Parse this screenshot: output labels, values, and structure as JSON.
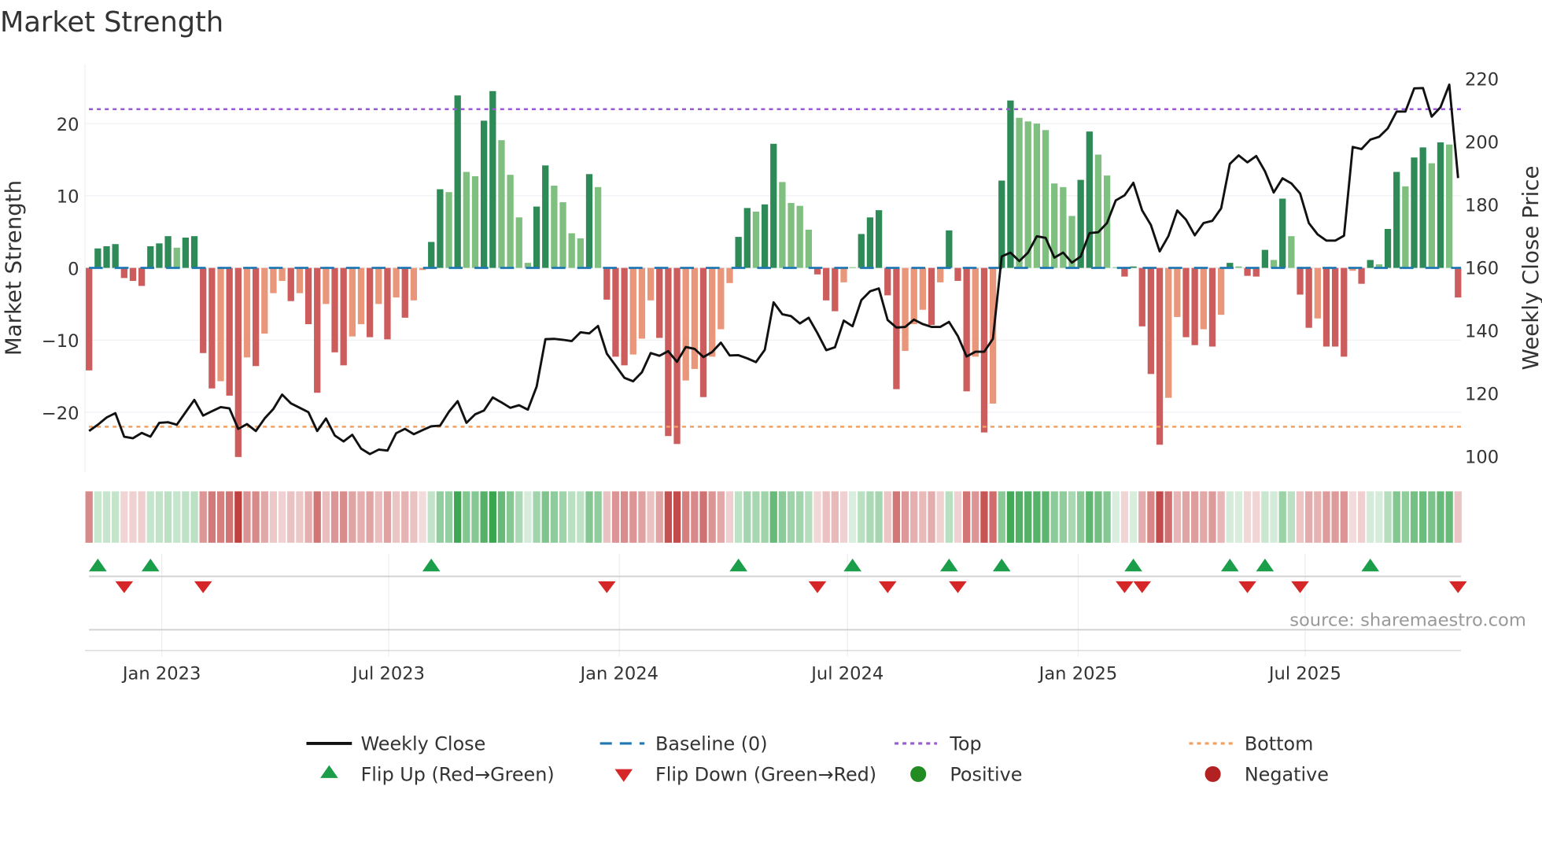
{
  "title": "Market Strength",
  "source": "source: sharemaestro.com",
  "colors": {
    "strong_green": "#2e8b57",
    "weak_green": "#7fbf7f",
    "strong_red": "#cd5c5c",
    "weak_red": "#e9967a",
    "line": "#111111",
    "baseline": "#1f77b4",
    "top": "#9b59d6",
    "bottom": "#f0a060",
    "flip_up": "#1a9e4a",
    "flip_down": "#d62728",
    "positive": "#228b22",
    "negative": "#b22222"
  },
  "legend": [
    {
      "key": "weekly_close",
      "label": "Weekly Close"
    },
    {
      "key": "baseline",
      "label": "Baseline (0)"
    },
    {
      "key": "top",
      "label": "Top"
    },
    {
      "key": "bottom",
      "label": "Bottom"
    },
    {
      "key": "flip_up",
      "label": "Flip Up (Red→Green)"
    },
    {
      "key": "flip_down",
      "label": "Flip Down (Green→Red)"
    },
    {
      "key": "positive",
      "label": "Positive"
    },
    {
      "key": "negative",
      "label": "Negative"
    }
  ],
  "chart_data": {
    "type": "bar",
    "title": "Market Strength",
    "frequency": "weekly",
    "start_date": "2022-11-04",
    "ylabel": "Market Strength",
    "y2label": "Weekly Close Price",
    "ylim": [
      -28,
      28.5
    ],
    "y2lim": [
      95,
      226
    ],
    "yticks": [
      {
        "v": 20,
        "label": "20"
      },
      {
        "v": 10,
        "label": "10"
      },
      {
        "v": 0,
        "label": "0"
      },
      {
        "v": -10,
        "label": "−10"
      },
      {
        "v": -20,
        "label": "−20"
      }
    ],
    "y2ticks": [
      {
        "v": 220,
        "label": "220"
      },
      {
        "v": 200,
        "label": "200"
      },
      {
        "v": 180,
        "label": "180"
      },
      {
        "v": 160,
        "label": "160"
      },
      {
        "v": 140,
        "label": "140"
      },
      {
        "v": 120,
        "label": "120"
      },
      {
        "v": 100,
        "label": "100"
      }
    ],
    "xticks": [
      {
        "date": "2023-01-01",
        "label": "Jan 2023"
      },
      {
        "date": "2023-07-01",
        "label": "Jul 2023"
      },
      {
        "date": "2024-01-01",
        "label": "Jan 2024"
      },
      {
        "date": "2024-07-01",
        "label": "Jul 2024"
      },
      {
        "date": "2025-01-01",
        "label": "Jan 2025"
      },
      {
        "date": "2025-07-01",
        "label": "Jul 2025"
      }
    ],
    "top_level": 22,
    "bottom_level": -22,
    "baseline": 0,
    "strength": [
      -14.2,
      2.7,
      3.0,
      3.3,
      -1.4,
      -1.8,
      -2.5,
      3.0,
      3.4,
      4.4,
      2.8,
      4.2,
      4.4,
      -11.8,
      -16.7,
      -15.7,
      -17.7,
      -26.2,
      -12.4,
      -13.6,
      -9.1,
      -3.5,
      -1.8,
      -4.6,
      -3.5,
      -7.8,
      -17.3,
      -5.0,
      -11.7,
      -13.5,
      -9.5,
      -7.8,
      -9.6,
      -5.0,
      -9.9,
      -4.1,
      -6.9,
      -4.5,
      -0.3,
      3.6,
      10.9,
      10.5,
      23.9,
      13.3,
      12.7,
      20.4,
      24.5,
      17.7,
      12.9,
      7.0,
      0.7,
      8.5,
      14.2,
      11.4,
      9.1,
      4.8,
      4.1,
      13.0,
      11.2,
      -4.4,
      -12.3,
      -13.5,
      -12.0,
      -9.8,
      -4.5,
      -9.7,
      -23.3,
      -24.4,
      -15.6,
      -14.0,
      -17.9,
      -12.3,
      -8.5,
      -2.1,
      4.3,
      8.3,
      7.8,
      8.8,
      17.2,
      11.9,
      9.0,
      8.6,
      5.3,
      -0.9,
      -4.5,
      -6.0,
      -2.0,
      0.1,
      4.7,
      7.0,
      8.0,
      -3.8,
      -16.8,
      -11.5,
      -7.8,
      -5.8,
      -7.9,
      -2.0,
      5.2,
      -1.8,
      -17.1,
      -12.3,
      -22.8,
      -18.8,
      12.1,
      23.2,
      20.8,
      20.3,
      20.0,
      19.1,
      11.7,
      11.2,
      7.2,
      12.2,
      18.9,
      15.7,
      12.8,
      0.1,
      -1.2,
      0.2,
      -8.1,
      -14.7,
      -24.5,
      -18.0,
      -6.8,
      -9.6,
      -10.7,
      -8.5,
      -10.9,
      -6.5,
      0.7,
      0.2,
      -1.1,
      -1.2,
      2.5,
      1.1,
      9.6,
      4.4,
      -3.7,
      -8.3,
      -7.0,
      -10.9,
      -10.9,
      -12.3,
      -0.4,
      -2.2,
      1.1,
      0.5,
      5.4,
      13.3,
      11.3,
      15.3,
      16.7,
      14.5,
      17.4,
      17.1,
      -4.1
    ],
    "shade": "SSSSSSSSSSWSSSSWSSWSWWWSWSSWSSWWSWSWSWWSSWSWWSSWWWWSSWWWWSWSSSWWWSSSWWSWWWSSWSSWWWWSSSWWSSSSSWWWSWSSSWSWSSWWWWWWWSSWWWSSSSSWWSSWSWSWSSSWSWSSWSSSWSSWSSWSSWSWS",
    "weekly_close": [
      108.0,
      110.0,
      112.3,
      113.7,
      106.2,
      105.7,
      107.4,
      106.2,
      110.6,
      110.8,
      110.0,
      114.0,
      117.9,
      112.9,
      114.3,
      115.6,
      115.2,
      108.7,
      110.2,
      108.0,
      112.0,
      115.0,
      119.6,
      116.8,
      115.4,
      114.0,
      108.0,
      112.0,
      106.6,
      104.7,
      106.8,
      102.4,
      100.7,
      102.1,
      101.8,
      107.3,
      108.7,
      107.0,
      108.3,
      109.5,
      109.7,
      114.1,
      117.5,
      110.6,
      113.3,
      114.5,
      118.7,
      117.1,
      115.4,
      116.2,
      114.8,
      122.1,
      137.2,
      137.3,
      137.0,
      136.6,
      139.4,
      139.0,
      141.4,
      132.6,
      128.8,
      124.9,
      123.8,
      126.7,
      132.8,
      131.9,
      133.4,
      130.0,
      134.7,
      134.1,
      131.5,
      133.1,
      136.1,
      132.0,
      132.1,
      131.1,
      129.9,
      133.8,
      148.9,
      145.1,
      144.5,
      142.2,
      144.0,
      139.1,
      133.7,
      134.6,
      143.1,
      141.3,
      149.6,
      152.4,
      153.3,
      143.3,
      140.9,
      141.1,
      143.4,
      142.0,
      141.1,
      141.1,
      142.7,
      138.2,
      131.7,
      133.2,
      133.2,
      137.3,
      163.5,
      164.7,
      162.0,
      164.7,
      169.9,
      169.4,
      163.1,
      164.7,
      161.5,
      163.5,
      170.9,
      171.2,
      174.1,
      181.3,
      182.9,
      186.9,
      178.1,
      173.5,
      165.1,
      170.0,
      178.1,
      175.2,
      170.2,
      174.1,
      174.8,
      178.8,
      192.9,
      195.6,
      193.4,
      195.4,
      190.5,
      183.8,
      188.3,
      186.7,
      183.5,
      174.1,
      170.5,
      168.5,
      168.5,
      170.1,
      198.3,
      197.6,
      200.6,
      201.5,
      204.2,
      209.5,
      209.5,
      216.9,
      217.0,
      207.9,
      210.9,
      218.1,
      188.4
    ],
    "legend_position": "bottom"
  }
}
